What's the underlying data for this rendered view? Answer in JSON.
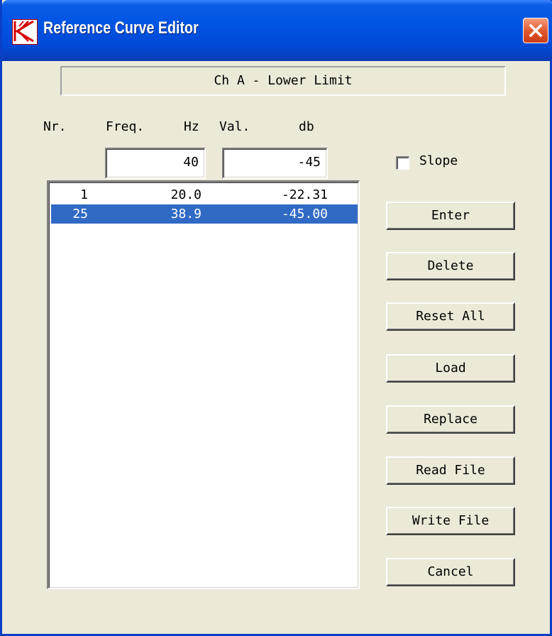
{
  "window": {
    "title": "Reference Curve Editor",
    "accent_color": "#0054e3",
    "close_icon": "close-icon",
    "app_icon": "k-logo-icon"
  },
  "heading": "Ch A - Lower Limit",
  "columns": {
    "nr": "Nr.",
    "freq": "Freq.",
    "freq_unit": "Hz",
    "val": "Val.",
    "val_unit": "db"
  },
  "inputs": {
    "freq_value": "40",
    "val_value": "-45"
  },
  "slope": {
    "label": "Slope",
    "checked": false
  },
  "list": {
    "rows": [
      {
        "nr": "1",
        "freq": "20.0",
        "val": "-22.31",
        "selected": false
      },
      {
        "nr": "25",
        "freq": "38.9",
        "val": "-45.00",
        "selected": true
      }
    ],
    "selection_color": "#316ac5"
  },
  "buttons": {
    "enter": "Enter",
    "delete": "Delete",
    "reset_all": "Reset All",
    "load": "Load",
    "replace": "Replace",
    "read_file": "Read File",
    "write_file": "Write File",
    "cancel": "Cancel"
  }
}
